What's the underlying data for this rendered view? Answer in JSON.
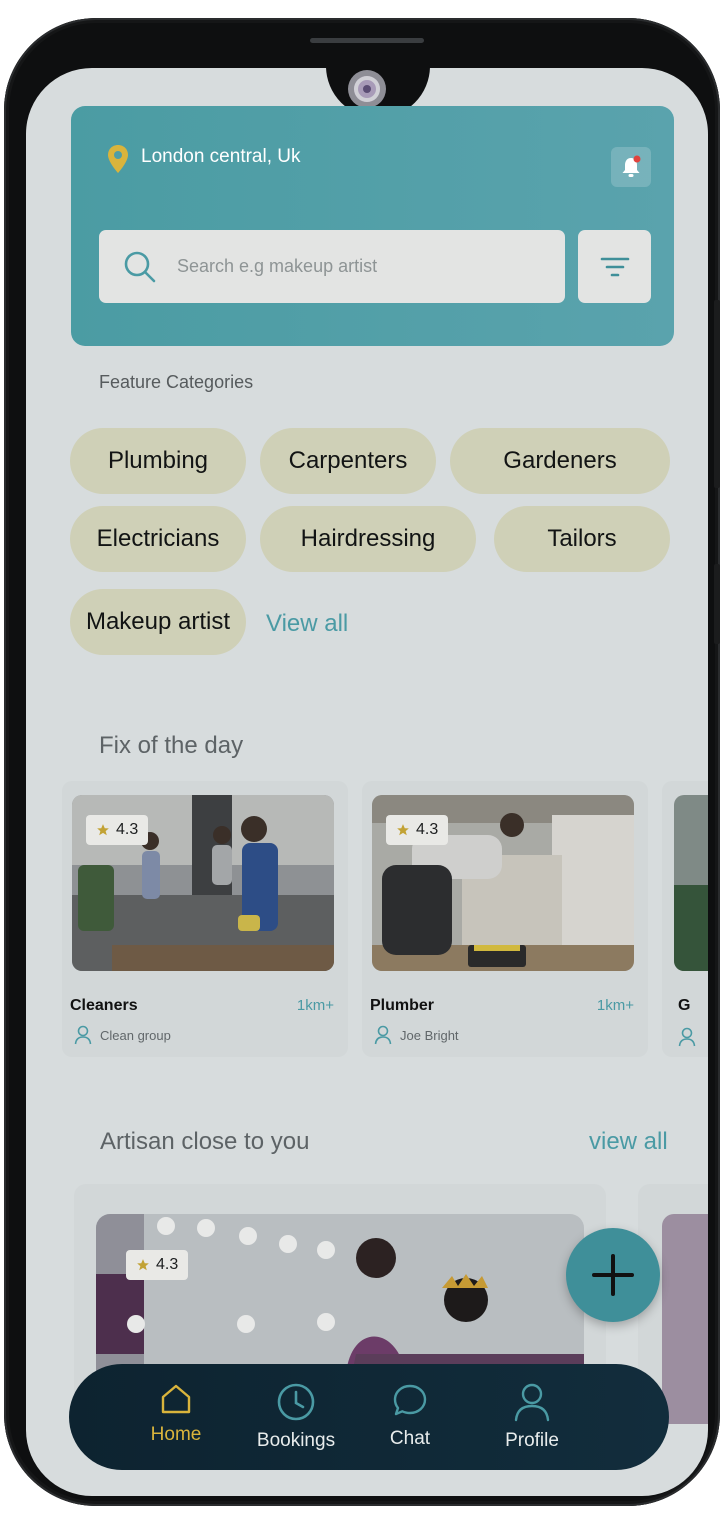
{
  "header": {
    "location": "London central, Uk",
    "search_placeholder": "Search e.g makeup artist"
  },
  "categories": {
    "title": "Feature Categories",
    "items": [
      "Plumbing",
      "Carpenters",
      "Gardeners",
      "Electricians",
      "Hairdressing",
      "Tailors",
      "Makeup artist"
    ],
    "view_all": "View all"
  },
  "fix_of_day": {
    "title": "Fix of the day",
    "cards": [
      {
        "rating": "4.3",
        "title": "Cleaners",
        "distance": "1km+",
        "owner": "Clean group"
      },
      {
        "rating": "4.3",
        "title": "Plumber",
        "distance": "1km+",
        "owner": "Joe Bright"
      },
      {
        "title": "G"
      }
    ]
  },
  "artisans": {
    "title": "Artisan close to you",
    "view_all": "view all",
    "cards": [
      {
        "rating": "4.3"
      }
    ]
  },
  "nav": {
    "items": [
      {
        "label": "Home",
        "icon": "home-icon",
        "active": true
      },
      {
        "label": "Bookings",
        "icon": "clock-icon",
        "active": false
      },
      {
        "label": "Chat",
        "icon": "chat-bubble-icon",
        "active": false
      },
      {
        "label": "Profile",
        "icon": "user-icon",
        "active": false
      }
    ]
  },
  "colors": {
    "accent": "#4b9ca3",
    "chip": "#cfd0b7",
    "nav_bg": "#0d2330",
    "active": "#d9b43c",
    "location_pin": "#d9b43c"
  }
}
